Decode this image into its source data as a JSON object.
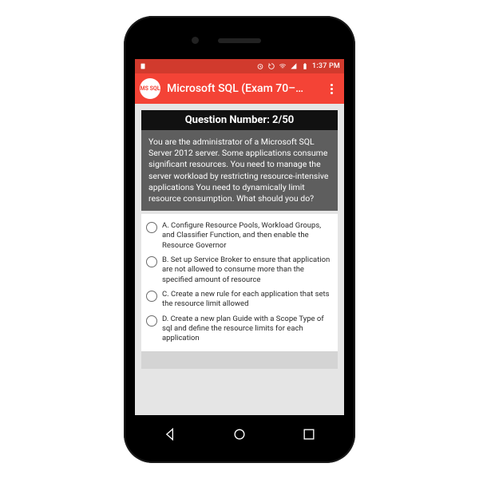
{
  "status": {
    "time": "1:37 PM"
  },
  "appbar": {
    "badge": "MS SQL",
    "title": "Microsoft SQL (Exam 70–…"
  },
  "question": {
    "counter": "Question Number: 2/50",
    "text": "You are the administrator of a Microsoft SQL Server 2012 server. Some applications consume significant resources. You need to manage the server workload by restricting resource-intensive applications You need to dynamically limit resource consumption. What should you do?"
  },
  "options": [
    "A. Configure Resource Pools, Workload Groups, and Classifier Function, and then enable the Resource Governor",
    "B. Set up Service Broker to ensure that application are not allowed to consume more than the specified amount of resource",
    "C. Create a new rule for each application that sets the resource limit allowed",
    "D. Create a new plan Guide with a Scope Type of sql and define the resource limits for each application"
  ]
}
